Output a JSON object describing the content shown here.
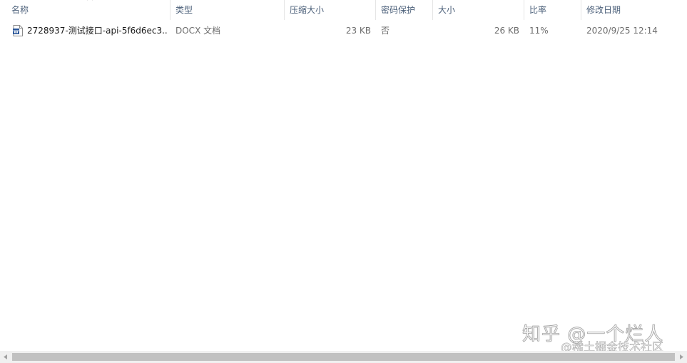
{
  "columns": {
    "name": "名称",
    "type": "类型",
    "compressed_size": "压缩大小",
    "password": "密码保护",
    "size": "大小",
    "ratio": "比率",
    "modified": "修改日期"
  },
  "sort": {
    "column": "name",
    "icon": "chevron-up-icon"
  },
  "files": [
    {
      "icon": "word-document-icon",
      "name": "2728937-测试接口-api-5f6d6ec3...",
      "type": "DOCX 文档",
      "compressed_size": "23 KB",
      "password": "否",
      "size": "26 KB",
      "ratio": "11%",
      "modified": "2020/9/25 12:14"
    }
  ],
  "watermark": {
    "main": "知乎 @一个烂人",
    "sub": "@稀土掘金技术社区"
  },
  "colors": {
    "header_text": "#4c607a",
    "word_icon_blue": "#2b579a",
    "scrollbar_thumb": "#c1c1c1"
  }
}
